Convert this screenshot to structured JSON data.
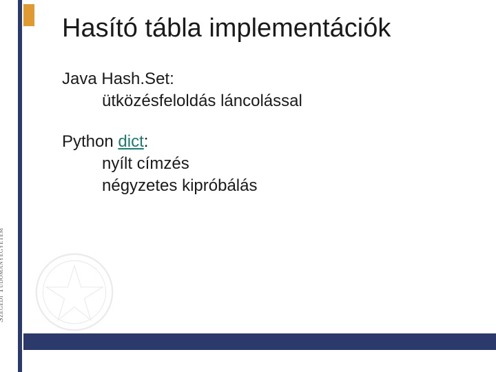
{
  "sidebar": {
    "university": "Szegedi Tudományegyetem"
  },
  "slide": {
    "title": "Hasító tábla implementációk",
    "section1": {
      "heading": "Java Hash.Set:",
      "line1": "ütközésfeloldás láncolással"
    },
    "section2": {
      "heading_prefix": "Python ",
      "heading_link": "dict",
      "heading_suffix": ":",
      "line1": "nyílt címzés",
      "line2": "négyzetes kipróbálás"
    }
  }
}
